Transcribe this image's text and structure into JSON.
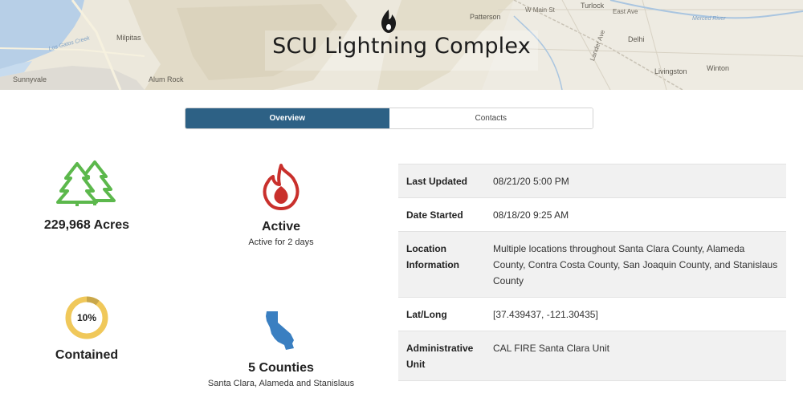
{
  "header": {
    "title": "SCU Lightning Complex",
    "map_labels": [
      "Milpitas",
      "Sunnyvale",
      "Alum Rock",
      "Patterson",
      "W Main St",
      "Turlock",
      "East Ave",
      "Merced River",
      "Delhi",
      "Livingston",
      "Winton",
      "Lander Ave",
      "Los Gatos Creek"
    ]
  },
  "tabs": [
    {
      "label": "Overview",
      "active": true
    },
    {
      "label": "Contacts",
      "active": false
    }
  ],
  "stats": {
    "acres": {
      "label": "229,968 Acres",
      "icon": "trees-icon"
    },
    "status": {
      "label": "Active",
      "sublabel": "Active for 2 days",
      "icon": "fire-icon"
    },
    "containment": {
      "percent_text": "10%",
      "percent": 10,
      "label": "Contained",
      "icon": "containment-ring"
    },
    "counties": {
      "label": "5 Counties",
      "sublabel": "Santa Clara, Alameda and Stanislaus",
      "icon": "california-icon"
    }
  },
  "info": [
    {
      "key": "Last Updated",
      "value": "08/21/20 5:00 PM"
    },
    {
      "key": "Date Started",
      "value": "08/18/20 9:25 AM"
    },
    {
      "key": "Location Information",
      "value": "Multiple locations throughout Santa Clara County, Alameda County, Contra Costa County, San Joaquin County, and Stanislaus County"
    },
    {
      "key": "Lat/Long",
      "value": "[37.439437, -121.30435]"
    },
    {
      "key": "Administrative Unit",
      "value": "CAL FIRE Santa Clara Unit"
    }
  ],
  "colors": {
    "tab_active": "#2d6185",
    "trees": "#5cb84c",
    "fire": "#c9302c",
    "ring": "#f0c85a",
    "california": "#3a7fc1"
  }
}
